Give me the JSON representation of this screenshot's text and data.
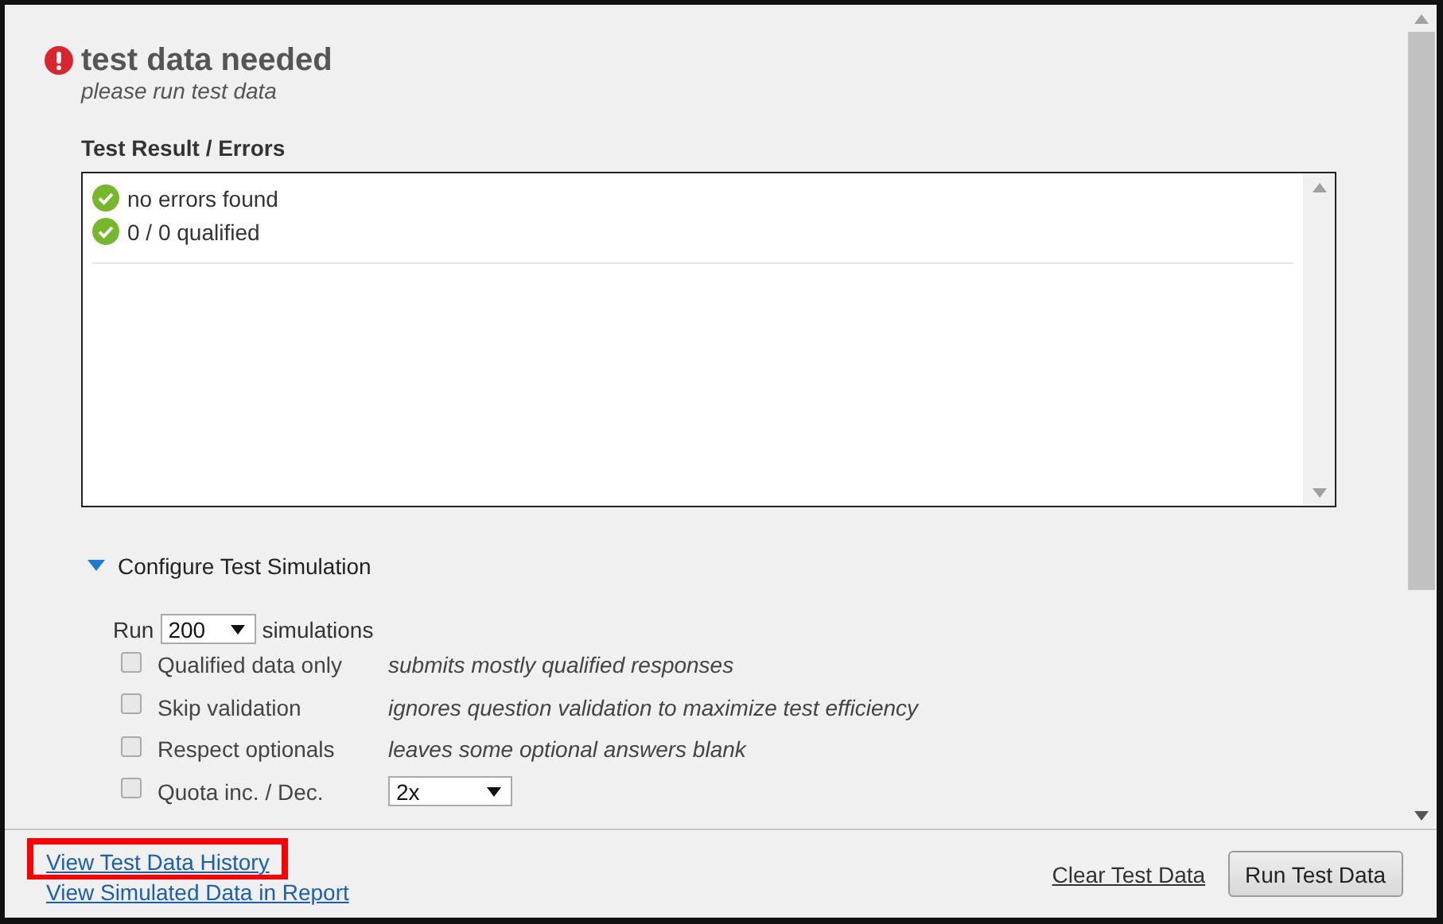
{
  "header": {
    "kind": "error",
    "title": "test data needed",
    "subtitle": "please run test data"
  },
  "results": {
    "label": "Test Result / Errors",
    "items": [
      {
        "kind": "ok",
        "text": "no errors found"
      },
      {
        "kind": "ok",
        "text": "0 / 0 qualified"
      }
    ]
  },
  "configure": {
    "label": "Configure Test Simulation",
    "expanded": true,
    "run_label": "Run",
    "runs": "200",
    "run_suffix": "simulations",
    "options": [
      {
        "kind": "description",
        "label": "Qualified data only",
        "checked": false,
        "description": "submits mostly qualified responses"
      },
      {
        "kind": "description",
        "label": "Skip validation",
        "checked": false,
        "description": "ignores question validation to maximize test efficiency"
      },
      {
        "kind": "description",
        "label": "Respect optionals",
        "checked": false,
        "description": "leaves some optional answers blank"
      },
      {
        "kind": "select",
        "label": "Quota inc. / Dec.",
        "checked": false,
        "value": "2x"
      }
    ]
  },
  "footer": {
    "links": [
      {
        "text": "View Test Data History",
        "highlighted": true
      },
      {
        "text": "View Simulated Data in Report",
        "highlighted": false
      }
    ],
    "clear_link": "Clear Test Data",
    "run_button": "Run Test Data"
  }
}
